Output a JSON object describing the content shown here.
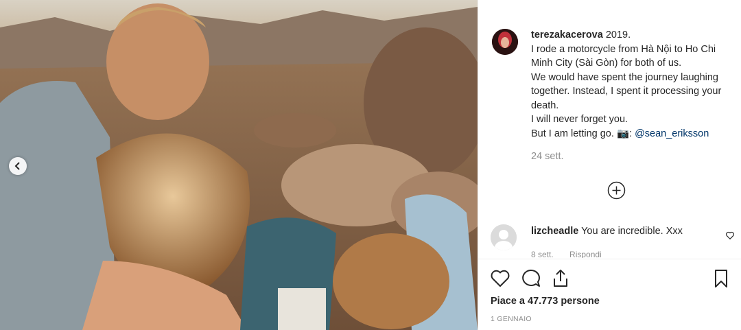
{
  "post": {
    "author": "terezakacerova",
    "caption_lines": [
      "2019.",
      "I rode a motorcycle from Hà Nội to Ho Chi Minh City (Sài Gòn) for both of us.",
      "We would have spent the journey laughing together. Instead, I spent it processing your death.",
      "I will never forget you.",
      "But I am letting go."
    ],
    "camera_emoji": "📷",
    "mention": "@sean_eriksson",
    "time_ago": "24 sett.",
    "likes_text": "Piace a 47.773 persone",
    "date": "1 GENNAIO"
  },
  "comment": {
    "user": "lizcheadle",
    "text": "You are incredible. Xxx",
    "time": "8 sett.",
    "reply": "Rispondi"
  },
  "colors": {
    "text": "#262626",
    "muted": "#8e8e8e",
    "link": "#003569",
    "border": "#efefef"
  },
  "icons": [
    "chevron-left-icon",
    "plus-circle-icon",
    "heart-icon",
    "comment-icon",
    "share-icon",
    "bookmark-icon"
  ]
}
